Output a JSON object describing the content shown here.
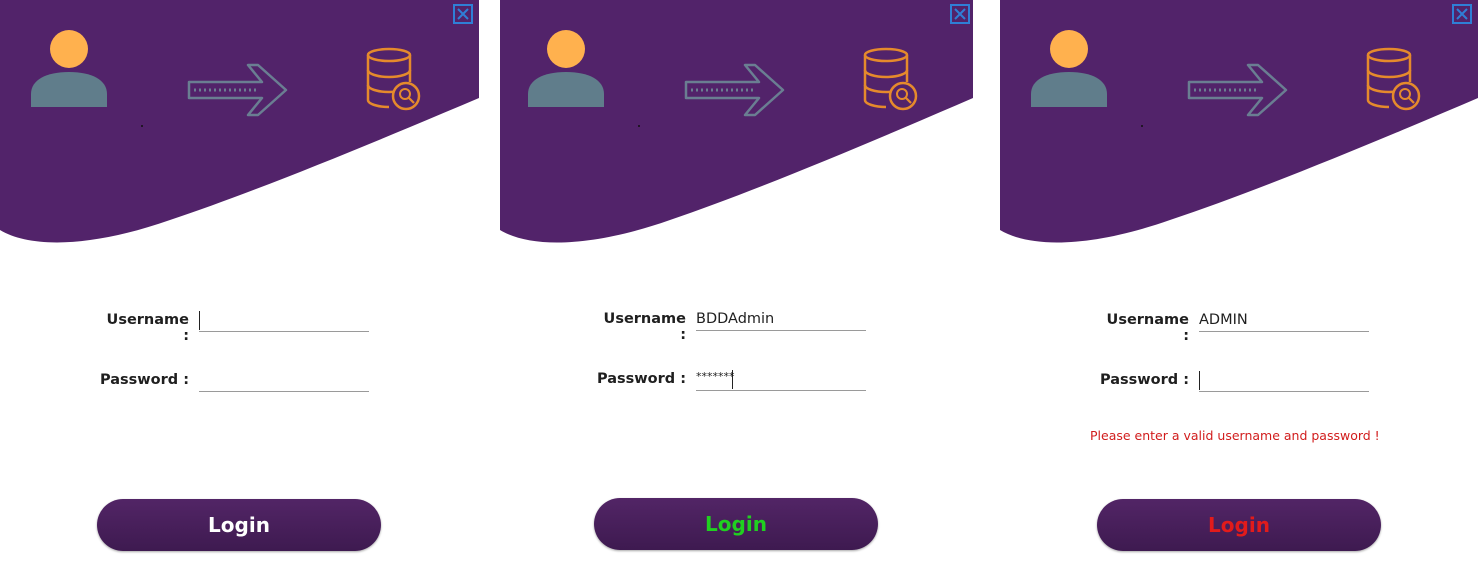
{
  "colors": {
    "header_purple": "#52236a",
    "button_purple": "#3f1a51",
    "avatar_head": "#ffb14e",
    "avatar_body": "#607d8b",
    "arrow": "#6a7e92",
    "database": "#e58a2c",
    "close_border": "#2f7fd6",
    "error_red": "#d11c1c",
    "login_white": "#ffffff",
    "login_green": "#20d020",
    "login_red": "#e21b1b"
  },
  "icons": {
    "close": "close-icon",
    "avatar": "user-avatar-icon",
    "arrow": "arrow-right-icon",
    "database": "database-search-icon"
  },
  "panels": [
    {
      "username_label": "Username :",
      "password_label": "Password :",
      "username_value": "",
      "password_value": "",
      "error_text": "",
      "login_label": "Login"
    },
    {
      "username_label": "Username :",
      "password_label": "Password :",
      "username_value": "BDDAdmin",
      "password_value": "*******",
      "error_text": "",
      "login_label": "Login"
    },
    {
      "username_label": "Username :",
      "password_label": "Password :",
      "username_value": "ADMIN",
      "password_value": "",
      "error_text": "Please enter a valid username and password !",
      "login_label": "Login"
    }
  ]
}
